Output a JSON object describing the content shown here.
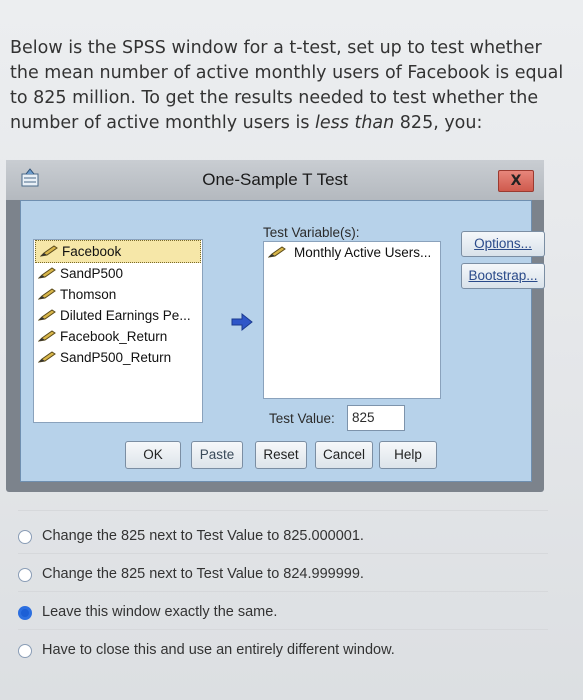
{
  "question": {
    "text_before": "Below is the SPSS window for a t-test, set up to test whether the mean number of active monthly users of Facebook is equal to 825 million. To get the results needed to test whether the number of active monthly users is ",
    "emph": "less than",
    "text_after": " 825, you:"
  },
  "dialog": {
    "title": "One-Sample T Test",
    "close_label": "X",
    "variables": [
      "Facebook",
      "SandP500",
      "Thomson",
      "Diluted Earnings Pe...",
      "Facebook_Return",
      "SandP500_Return"
    ],
    "test_variables_label": "Test Variable(s):",
    "test_variables": [
      "Monthly Active Users..."
    ],
    "options_label": "Options...",
    "bootstrap_label": "Bootstrap...",
    "test_value_label": "Test Value:",
    "test_value": "825",
    "buttons": {
      "ok": "OK",
      "paste": "Paste",
      "reset": "Reset",
      "cancel": "Cancel",
      "help": "Help"
    }
  },
  "options": [
    {
      "text": "Change the 825 next to Test Value to 825.000001.",
      "selected": false
    },
    {
      "text": "Change the 825 next to Test Value to 824.999999.",
      "selected": false
    },
    {
      "text": "Leave this window exactly the same.",
      "selected": true
    },
    {
      "text": "Have to close this and use an entirely different window.",
      "selected": false
    }
  ],
  "colors": {
    "radio_selected": "#1c5fd6",
    "dialog_body": "#b7d2ea",
    "selected_item": "#f6e7a8"
  }
}
